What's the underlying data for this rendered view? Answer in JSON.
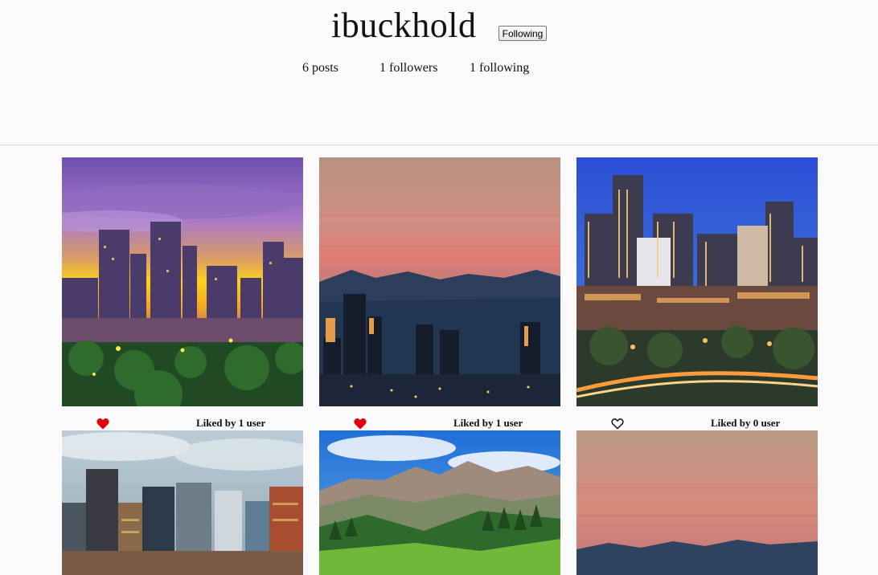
{
  "profile": {
    "username": "ibuckhold",
    "follow_button_label": "Following",
    "posts_label": "6 posts",
    "followers_label": "1 followers",
    "following_label": "1 following"
  },
  "posts": [
    {
      "liked": true,
      "likes_text": "Liked by 1 user"
    },
    {
      "liked": true,
      "likes_text": "Liked by 1 user"
    },
    {
      "liked": false,
      "likes_text": "Liked by 0 user"
    },
    {},
    {},
    {}
  ],
  "colors": {
    "liked_heart": "#e0000f",
    "unliked_heart_stroke": "#111111",
    "header_border": "#dcdcdc",
    "background": "#fafafa"
  },
  "icons": {
    "liked": "heart-filled-icon",
    "unliked": "heart-outline-icon"
  }
}
